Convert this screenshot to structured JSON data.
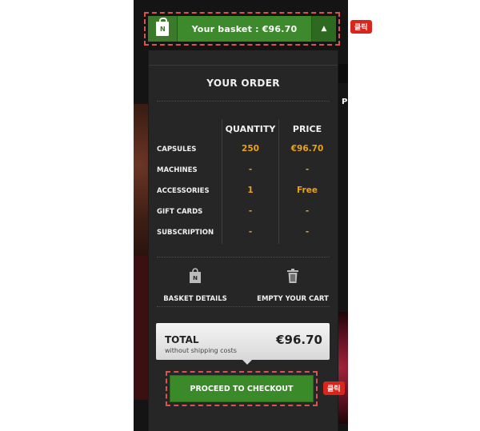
{
  "basket": {
    "label": "Your basket  : €96.70",
    "caret": "▲",
    "click_tag": "클릭"
  },
  "order": {
    "title": "YOUR ORDER",
    "columns": [
      "QUANTITY",
      "PRICE"
    ],
    "rows": [
      {
        "label": "CAPSULES",
        "quantity": "250",
        "price": "€96.70"
      },
      {
        "label": "MACHINES",
        "quantity": "-",
        "price": "-"
      },
      {
        "label": "ACCESSORIES",
        "quantity": "1",
        "price": "Free"
      },
      {
        "label": "GIFT CARDS",
        "quantity": "-",
        "price": "-"
      },
      {
        "label": "SUBSCRIPTION",
        "quantity": "-",
        "price": "-"
      }
    ]
  },
  "actions": {
    "basket_details": "BASKET DETAILS",
    "empty_cart": "EMPTY YOUR CART"
  },
  "total": {
    "label": "TOTAL",
    "sub": "without shipping costs",
    "value": "€96.70"
  },
  "checkout": {
    "label": "PROCEED TO CHECKOUT",
    "click_tag": "클릭"
  },
  "background": {
    "right_text": "Pr"
  },
  "colors": {
    "accent_green": "#3d8a2c",
    "value_orange": "#e8a21c",
    "annotation_red": "#d9261c"
  }
}
